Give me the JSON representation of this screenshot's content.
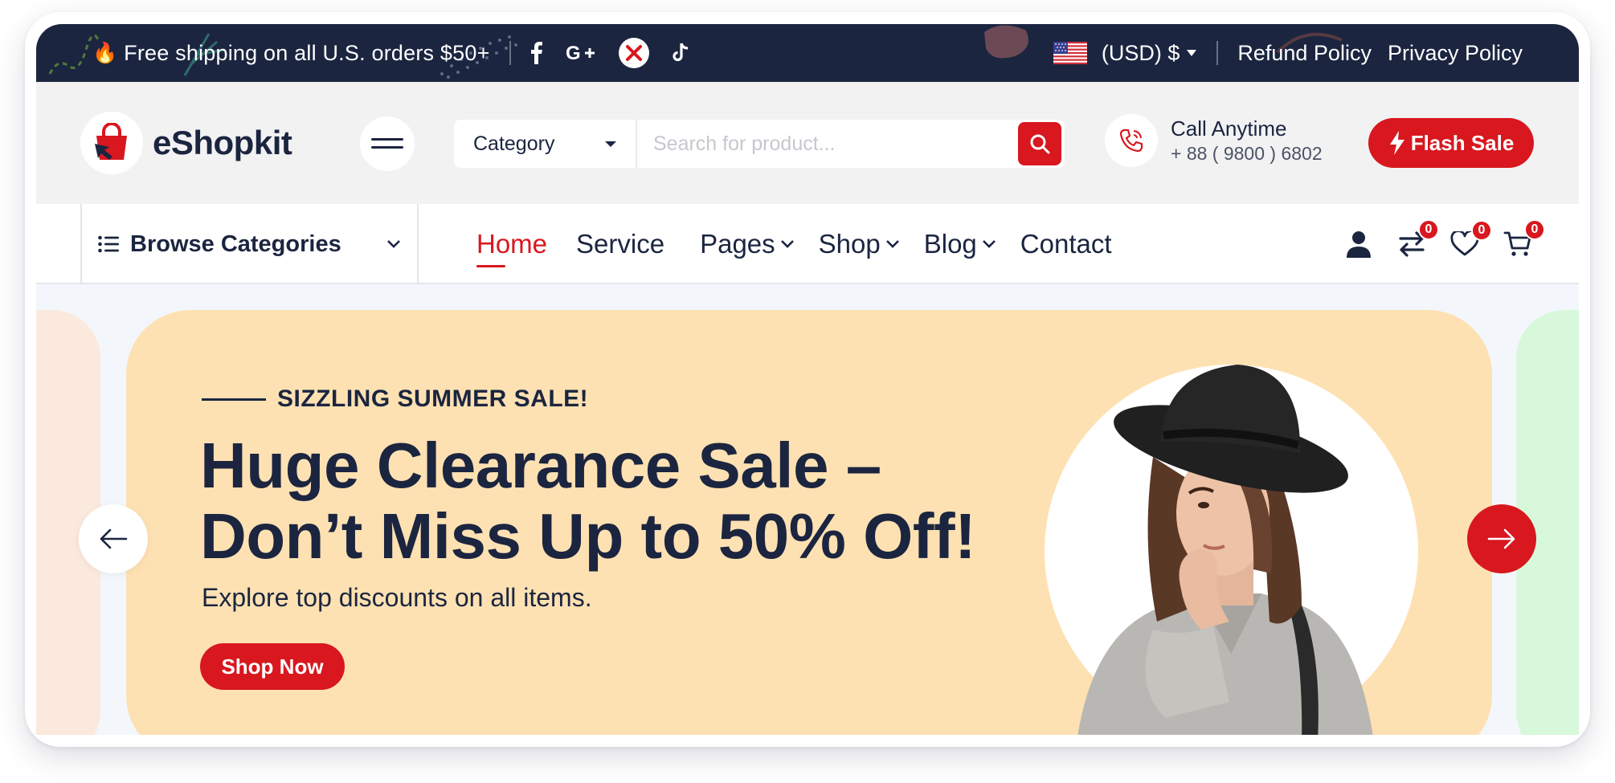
{
  "topbar": {
    "fire_icon": "🔥",
    "shipping_text": "Free shipping on all U.S. orders $50+",
    "social_icons": [
      "facebook-icon",
      "google-plus-icon",
      "x-icon",
      "tiktok-icon"
    ],
    "currency": "(USD) $",
    "refund_policy": "Refund Policy",
    "privacy_policy": "Privacy Policy"
  },
  "header": {
    "logo_text": "eShopkit",
    "category_label": "Category",
    "search_placeholder": "Search for product...",
    "call_title": "Call Anytime",
    "call_phone": "+ 88 ( 9800 ) 6802",
    "flash_sale": "Flash Sale"
  },
  "nav": {
    "browse_label": "Browse Categories",
    "items": [
      {
        "label": "Home",
        "active": true,
        "has_dropdown": false
      },
      {
        "label": "Service",
        "active": false,
        "has_dropdown": false
      },
      {
        "label": "Pages",
        "active": false,
        "has_dropdown": true
      },
      {
        "label": "Shop",
        "active": false,
        "has_dropdown": true
      },
      {
        "label": "Blog",
        "active": false,
        "has_dropdown": true
      },
      {
        "label": "Contact",
        "active": false,
        "has_dropdown": false
      }
    ],
    "compare_count": "0",
    "wishlist_count": "0",
    "cart_count": "0"
  },
  "hero": {
    "eyebrow": "SIZZLING SUMMER SALE!",
    "headline_line1": "Huge Clearance Sale –",
    "headline_line2": "Don’t Miss Up to 50% Off!",
    "subtext": "Explore top discounts on all items.",
    "cta": "Shop Now"
  },
  "colors": {
    "brand_red": "#d8171f",
    "navy": "#1b2540",
    "slide_bg": "#fee1b2",
    "left_card_bg": "#fbe9dd",
    "right_card_bg": "#d7f8db"
  }
}
